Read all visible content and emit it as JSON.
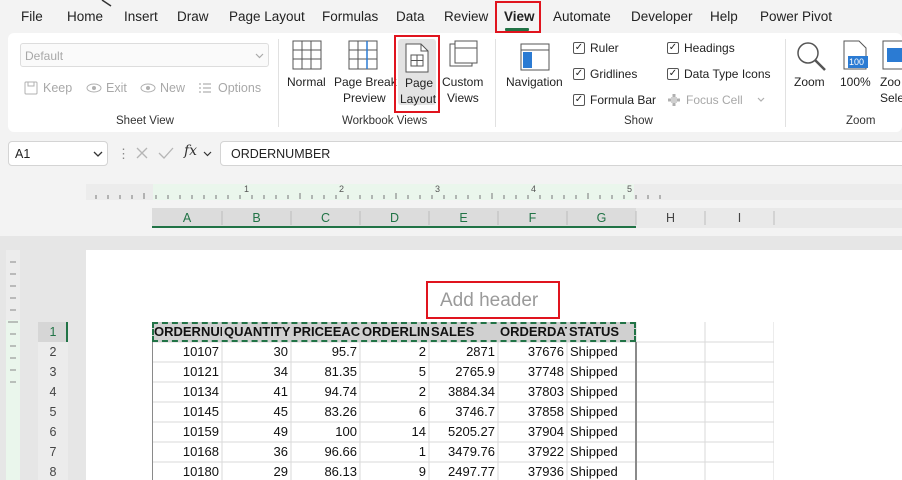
{
  "menu": {
    "items": [
      "File",
      "Home",
      "Insert",
      "Draw",
      "Page Layout",
      "Formulas",
      "Data",
      "Review",
      "View",
      "Automate",
      "Developer",
      "Help",
      "Power Pivot"
    ],
    "active": "View"
  },
  "ribbon": {
    "sheet_view": {
      "dropdown_value": "Default",
      "keep": "Keep",
      "exit": "Exit",
      "new": "New",
      "options": "Options",
      "label": "Sheet View"
    },
    "workbook_views": {
      "normal": "Normal",
      "page_break_1": "Page Break",
      "page_break_2": "Preview",
      "page_layout_1": "Page",
      "page_layout_2": "Layout",
      "custom_1": "Custom",
      "custom_2": "Views",
      "label": "Workbook Views"
    },
    "show": {
      "navigation": "Navigation",
      "ruler": "Ruler",
      "gridlines": "Gridlines",
      "formula_bar": "Formula Bar",
      "headings": "Headings",
      "data_type_icons": "Data Type Icons",
      "focus_cell": "Focus Cell",
      "label": "Show"
    },
    "zoom": {
      "zoom": "Zoom",
      "hundred": "100%",
      "hundred_icon": "100",
      "zoom_sel_1": "Zoo",
      "zoom_sel_2": "Sele",
      "label": "Zoom"
    }
  },
  "formula_bar": {
    "name_box": "A1",
    "fx": "fx",
    "content": "ORDERNUMBER"
  },
  "ruler": {
    "numbers": [
      "1",
      "2",
      "3",
      "4",
      "5"
    ]
  },
  "sheet": {
    "columns": [
      "A",
      "B",
      "C",
      "D",
      "E",
      "F",
      "G",
      "H",
      "I"
    ],
    "add_header": "Add header",
    "rows": [
      "1",
      "2",
      "3",
      "4",
      "5",
      "6",
      "7",
      "8"
    ],
    "headers": [
      "ORDERNUMBER",
      "QUANTITYORDERED",
      "PRICEEACH",
      "ORDERLINENUMBER",
      "SALES",
      "ORDERDATE",
      "STATUS"
    ],
    "data": [
      [
        "10107",
        "30",
        "95.7",
        "2",
        "2871",
        "37676",
        "Shipped"
      ],
      [
        "10121",
        "34",
        "81.35",
        "5",
        "2765.9",
        "37748",
        "Shipped"
      ],
      [
        "10134",
        "41",
        "94.74",
        "2",
        "3884.34",
        "37803",
        "Shipped"
      ],
      [
        "10145",
        "45",
        "83.26",
        "6",
        "3746.7",
        "37858",
        "Shipped"
      ],
      [
        "10159",
        "49",
        "100",
        "14",
        "5205.27",
        "37904",
        "Shipped"
      ],
      [
        "10168",
        "36",
        "96.66",
        "1",
        "3479.76",
        "37922",
        "Shipped"
      ],
      [
        "10180",
        "29",
        "86.13",
        "9",
        "2497.77",
        "37936",
        "Shipped"
      ]
    ]
  }
}
